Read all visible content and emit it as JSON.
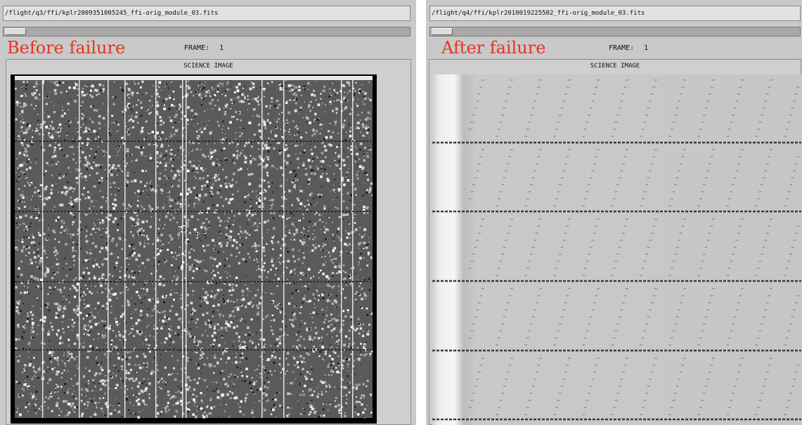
{
  "left_panel": {
    "file_path": "/flight/q3/ffi/kplr2009351005245_ffi-orig_module_03.fits",
    "label": "Before failure",
    "frame_label": "FRAME:",
    "frame_value": "1",
    "image_title": "SCIENCE IMAGE"
  },
  "right_panel": {
    "file_path": "/flight/q4/ffi/kplr2010019225502_ffi-orig_module_03.fits",
    "label": "After failure",
    "frame_label": "FRAME:",
    "frame_value": "1",
    "image_title": "SCIENCE IMAGE"
  },
  "colors": {
    "label_red": "#e8341c",
    "panel_bg": "#c9c9c9"
  }
}
